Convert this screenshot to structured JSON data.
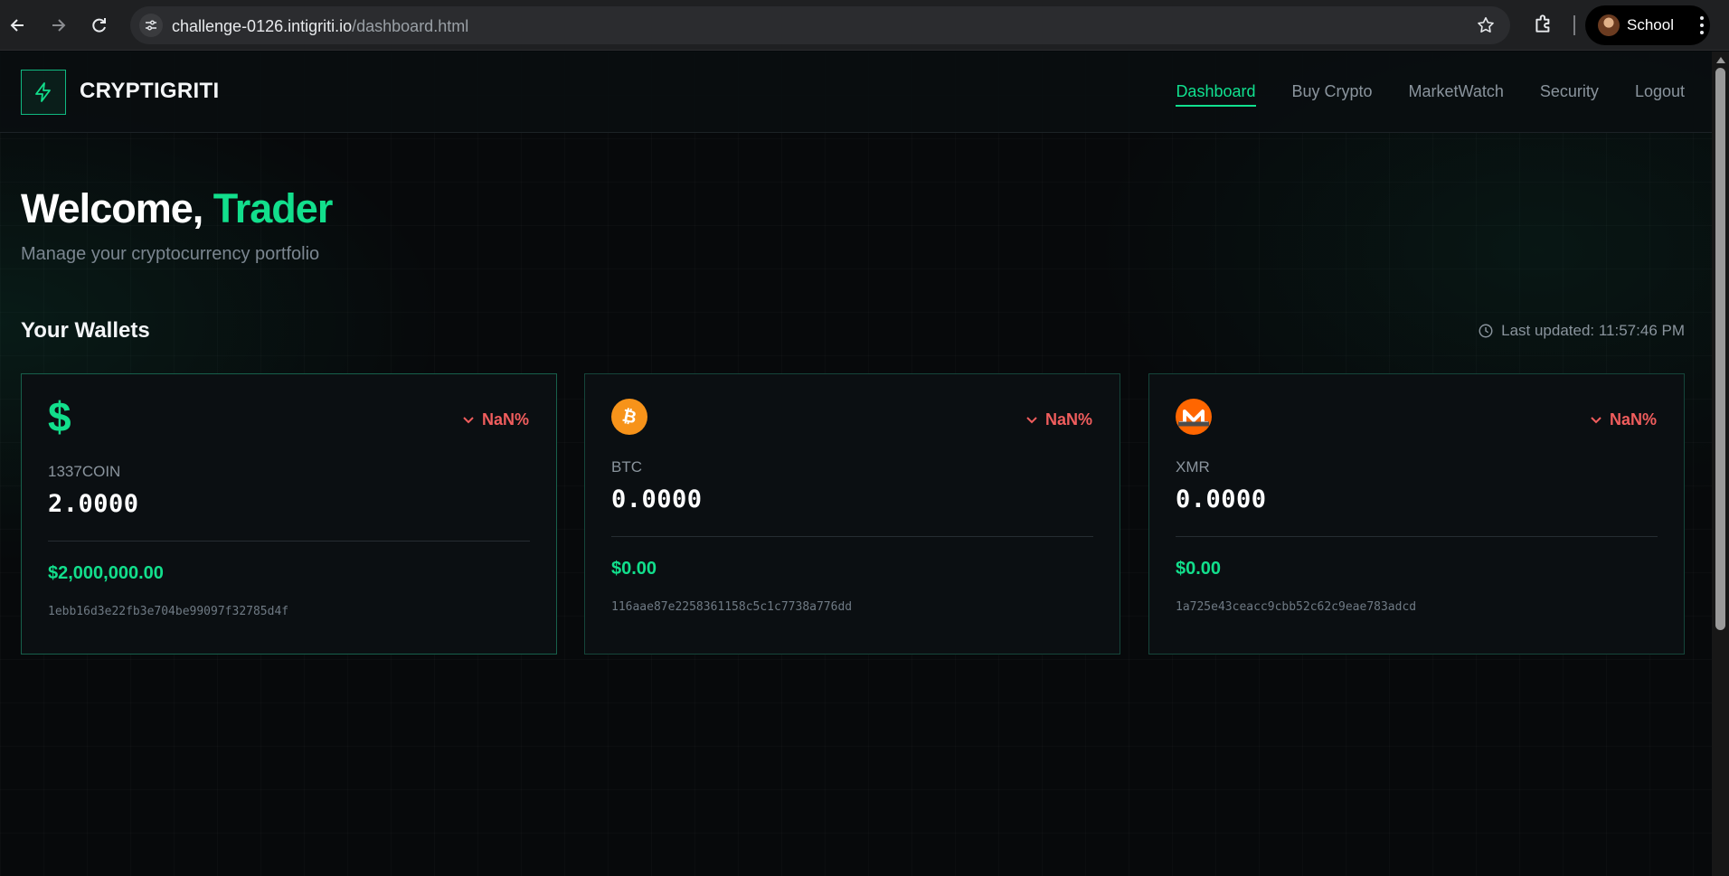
{
  "browser": {
    "url_host": "challenge-0126.intigriti.io",
    "url_path": "/dashboard.html",
    "profile_name": "School"
  },
  "site": {
    "brand": "CRYPTIGRITI",
    "nav": [
      {
        "label": "Dashboard",
        "active": true
      },
      {
        "label": "Buy Crypto"
      },
      {
        "label": "MarketWatch"
      },
      {
        "label": "Security"
      },
      {
        "label": "Logout"
      }
    ]
  },
  "hero": {
    "welcome_prefix": "Welcome,",
    "welcome_name": "Trader",
    "subtitle": "Manage your cryptocurrency portfolio"
  },
  "wallets_section": {
    "title": "Your Wallets",
    "last_updated": "Last updated: 11:57:46 PM"
  },
  "wallets": [
    {
      "icon": "dollar-icon",
      "symbol": "1337COIN",
      "amount": "2.0000",
      "usd": "$2,000,000.00",
      "address": "1ebb16d3e22fb3e704be99097f32785d4f",
      "change": "NaN%"
    },
    {
      "icon": "bitcoin-icon",
      "symbol": "BTC",
      "amount": "0.0000",
      "usd": "$0.00",
      "address": "116aae87e2258361158c5c1c7738a776dd",
      "change": "NaN%"
    },
    {
      "icon": "monero-icon",
      "symbol": "XMR",
      "amount": "0.0000",
      "usd": "$0.00",
      "address": "1a725e43ceacc9cbb52c62c9eae783adcd",
      "change": "NaN%"
    }
  ],
  "colors": {
    "accent": "#12df8c",
    "negative": "#f05d5d",
    "bitcoin": "#f7931a",
    "monero": "#ff6600",
    "background": "#07090b"
  }
}
